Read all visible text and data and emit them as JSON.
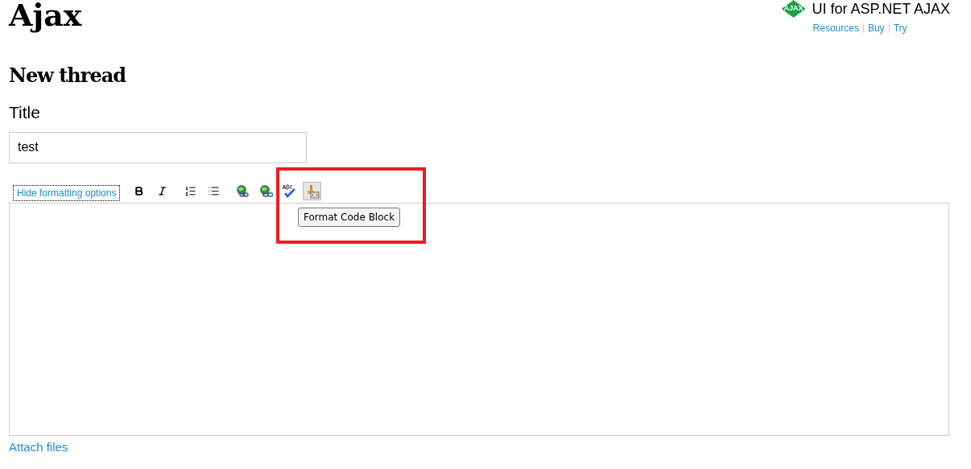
{
  "header": {
    "site_title": "Ajax",
    "product": "UI for ASP.NET AJAX",
    "logo_text": "AJAX",
    "links": [
      "Resources",
      "Buy",
      "Try"
    ]
  },
  "page_title": "New thread",
  "title_field": {
    "label": "Title",
    "value": "test"
  },
  "toolbar": {
    "toggle": "Hide formatting options",
    "tools": [
      {
        "kind": "bold",
        "hovered": false
      },
      {
        "kind": "italic",
        "hovered": false
      },
      {
        "kind": "ordered-list",
        "hovered": false
      },
      {
        "kind": "bullet-list",
        "hovered": false
      },
      {
        "kind": "link",
        "hovered": false
      },
      {
        "kind": "unlink",
        "hovered": false
      },
      {
        "kind": "spellcheck",
        "hovered": false
      },
      {
        "kind": "code",
        "hovered": true
      }
    ]
  },
  "tooltip": "Format Code Block",
  "attach_link": "Attach files"
}
